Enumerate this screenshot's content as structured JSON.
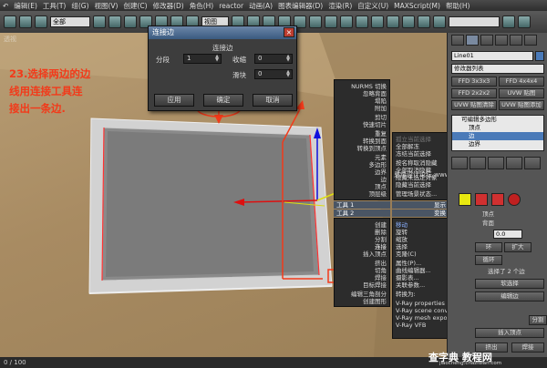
{
  "menu": [
    "↶",
    "编辑(E)",
    "工具(T)",
    "组(G)",
    "视图(V)",
    "创建(C)",
    "修改器(D)",
    "角色(H)",
    "reactor",
    "动画(A)",
    "图表编辑器(D)",
    "渲染(R)",
    "自定义(U)",
    "MAXScript(M)",
    "帮助(H)"
  ],
  "toolbar": {
    "selection_filter": "全部",
    "view_dropdown": "视图"
  },
  "viewport": {
    "label": "透视"
  },
  "dialog": {
    "title": "连接边",
    "close": "×",
    "group_label": "连接边",
    "segments_label": "分段",
    "segments_value": "1",
    "pinch_label": "收缩",
    "pinch_value": "0",
    "slide_label": "滑块",
    "slide_value": "0",
    "apply": "应用",
    "ok": "确定",
    "cancel": "取消"
  },
  "annotation": [
    "23.选择两边的边",
    "线用连接工具连",
    "接出一条边."
  ],
  "quad_menu": {
    "top_left": [
      "NURMS 切换",
      "忽略背面",
      "塌陷",
      "附加",
      "剪切",
      "快速切片",
      "重复",
      "转换到面",
      "转换到顶点",
      "元素",
      "多边形",
      "边界",
      "边",
      "顶点",
      "顶层级"
    ],
    "top_right": [
      "孤立当前选择",
      "全部解冻",
      "冻结当前选择",
      "按名称取消隐藏",
      "全部取消隐藏",
      "隐藏未选定对象",
      "隐藏当前选择",
      "管理场景状态..."
    ],
    "tools1_header": "工具 1",
    "display_header": "显示",
    "tools2_header": "工具 2",
    "transform_header": "变换",
    "bottom_left": [
      "创建",
      "删除",
      "分割",
      "连接",
      "插入顶点",
      "挤出",
      "切角",
      "焊接",
      "目标焊接",
      "编辑三角剖分",
      "创建图形"
    ],
    "bottom_right": [
      "移动",
      "旋转",
      "缩放",
      "选择",
      "克隆(C)",
      "属性(P)...",
      "曲线编辑器...",
      "摄影表...",
      "关联参数...",
      "转换为:",
      "V-Ray properties",
      "V-Ray scene converter",
      "V-Ray mesh export",
      "V-Ray VFB"
    ]
  },
  "command_panel": {
    "object_name": "Line01",
    "modifier_list": "修改器列表",
    "ffd1": "FFD 3x3x3",
    "ffd2": "FFD 4x4x4",
    "ffd3": "FFD 2x2x2",
    "uvw_map": "UVW 贴图",
    "uvw_clear": "UVW 贴图清除",
    "uvw_add": "UVW 贴图添加",
    "stack": [
      "可编辑多边形",
      "顶点",
      "边",
      "边界"
    ],
    "vertex_label": "顶点",
    "backface_label": "背面",
    "value_label": "0.0",
    "ring": "环",
    "expand": "扩大",
    "loop": "循环",
    "selected": "选择了 2 个边",
    "soft_select": "软选择",
    "edit_edges": "编辑边",
    "insert_vertex": "插入顶点",
    "extrude": "挤出",
    "split": "分割",
    "weld": "焊接"
  },
  "watermark": "思缘设计论坛 www.MISSYUAN.com",
  "status": {
    "frame": "0 / 100"
  },
  "logo": {
    "main": "查字典 教程网",
    "sub": "jiaocheng.chazidian.com"
  },
  "colors": {
    "annotation": "#f23a1a",
    "dialog_title": "#3a5a80",
    "highlight": "#4a7ab8"
  }
}
